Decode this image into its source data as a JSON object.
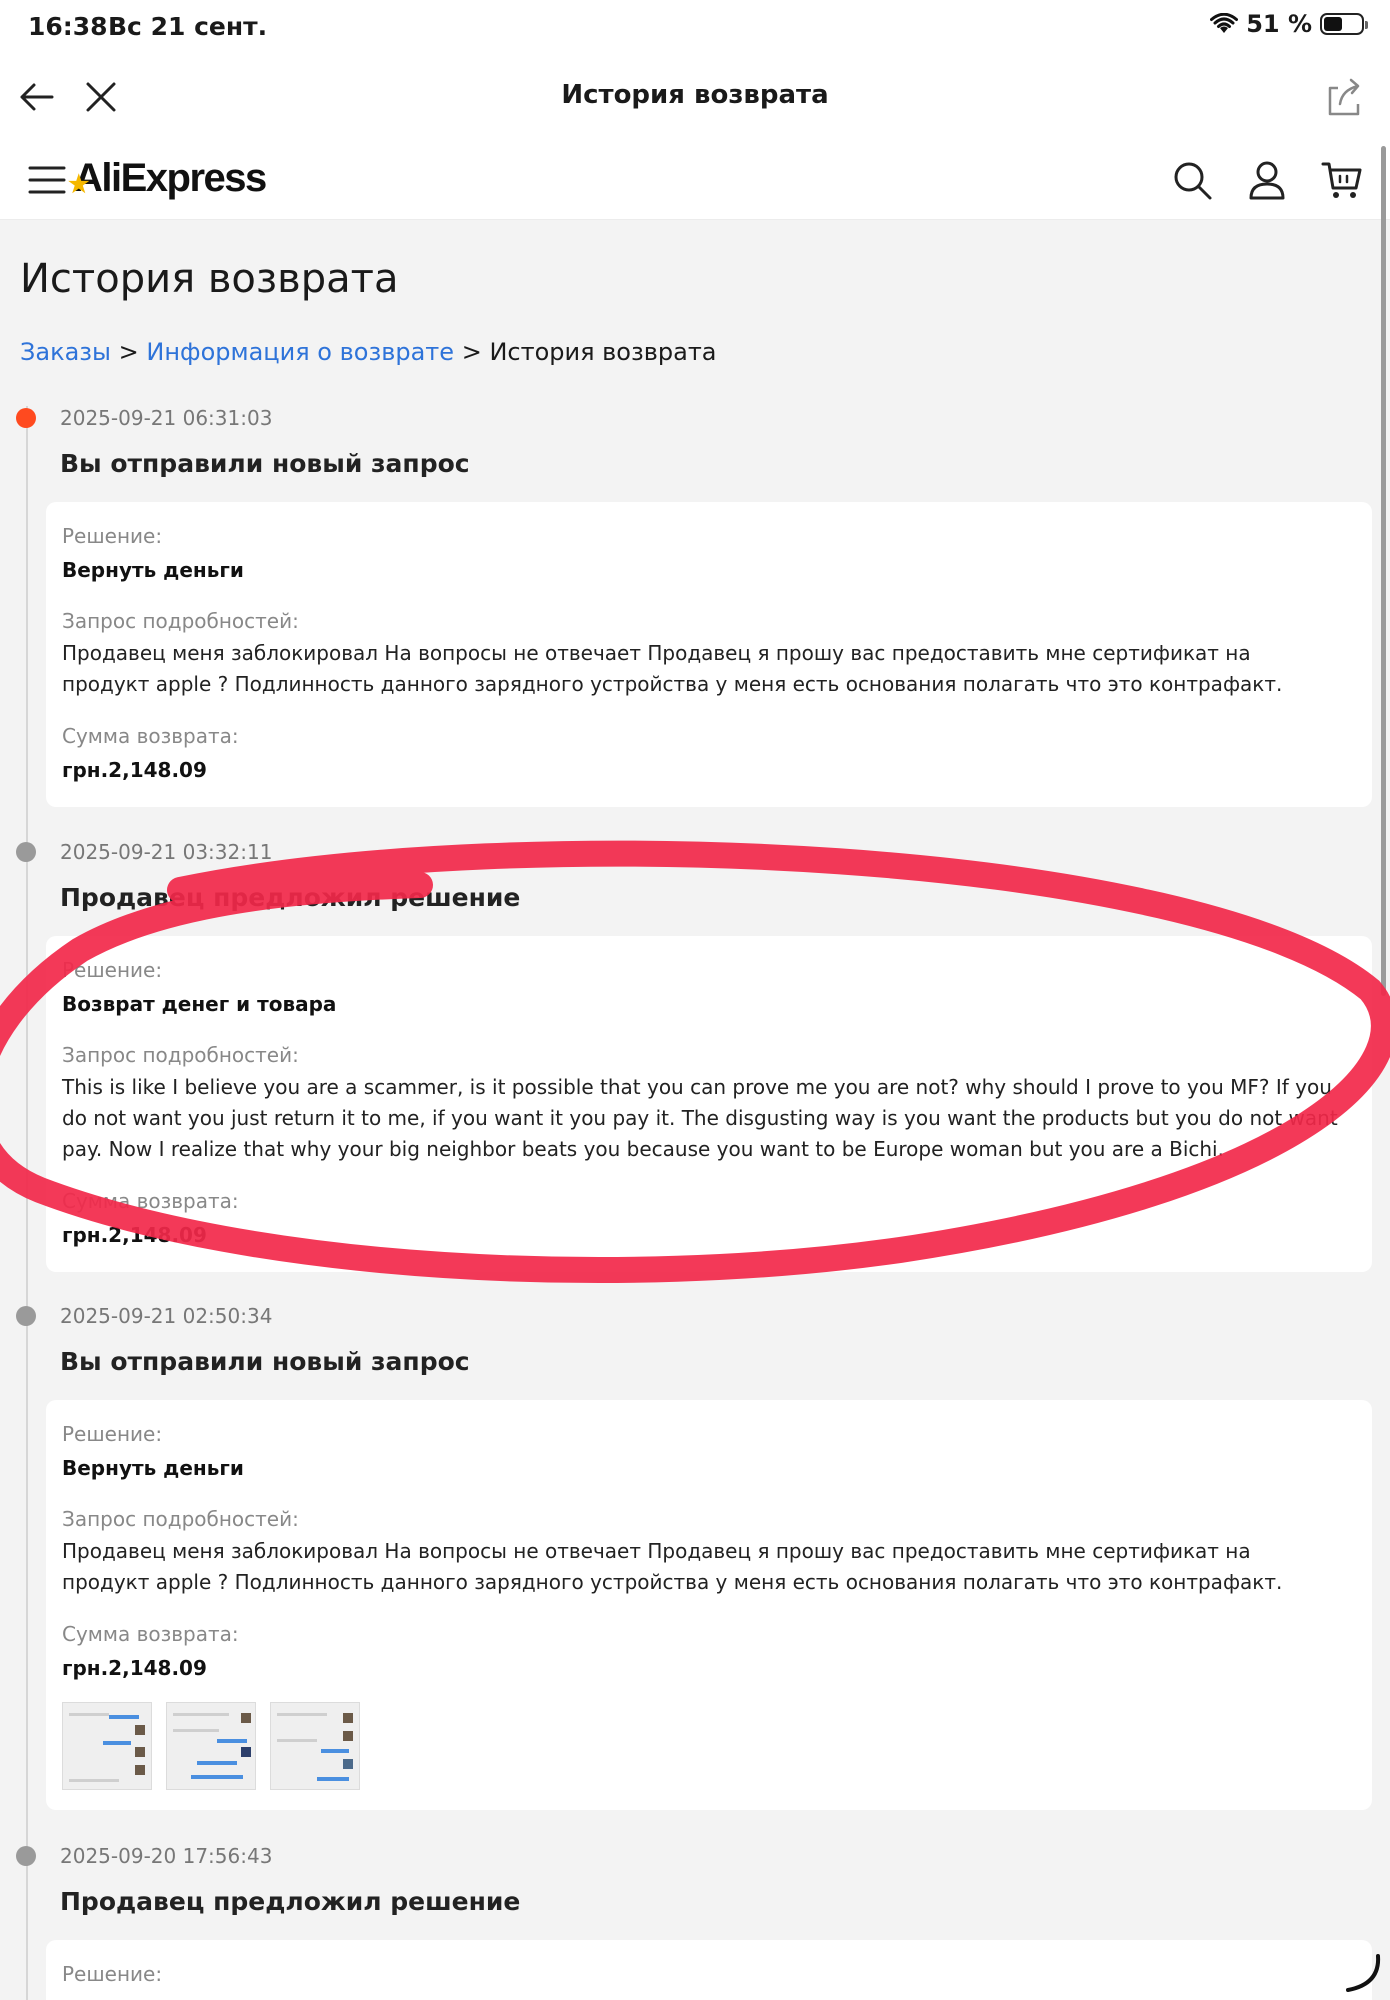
{
  "status_bar": {
    "time": "16:38",
    "date": "Вс 21 сент.",
    "battery": "51 %",
    "battery_level": 0.51
  },
  "nav": {
    "title": "История возврата"
  },
  "app": {
    "logo": "AliExpress"
  },
  "page": {
    "title": "История возврата",
    "breadcrumb": {
      "orders": "Заказы",
      "sep1": ">",
      "info": "Информация о возврате",
      "sep2": ">",
      "current": "История возврата"
    }
  },
  "entries": [
    {
      "timestamp": "2025-09-21 06:31:03",
      "title": "Вы отправили новый запрос",
      "decision_label": "Решение:",
      "decision": "Вернуть деньги",
      "details_label": "Запрос подробностей:",
      "details": "Продавец меня заблокировал На вопросы не отвечает Продавец я прошу вас предоставить мне сертификат на продукт apple ? Подлинность данного зарядного устройства у меня есть основания полагать что это контрафакт.",
      "amount_label": "Сумма возврата:",
      "amount": "грн.2,148.09"
    },
    {
      "timestamp": "2025-09-21 03:32:11",
      "title": "Продавец предложил решение",
      "decision_label": "Решение:",
      "decision": "Возврат денег и товара",
      "details_label": "Запрос подробностей:",
      "details": "This is like I believe you are a scammer, is it possible that you can prove me you are not? why should I prove to you MF? If you do not want you just return it to me, if you want it you pay it. The disgusting way is you want the products but you do not want pay. Now I realize that why your big neighbor beats you because you want to be Europe woman but you are a Bichi.",
      "amount_label": "Сумма возврата:",
      "amount": "грн.2,148.09"
    },
    {
      "timestamp": "2025-09-21 02:50:34",
      "title": "Вы отправили новый запрос",
      "decision_label": "Решение:",
      "decision": "Вернуть деньги",
      "details_label": "Запрос подробностей:",
      "details": "Продавец меня заблокировал На вопросы не отвечает Продавец я прошу вас предоставить мне сертификат на продукт apple ? Подлинность данного зарядного устройства у меня есть основания полагать что это контрафакт.",
      "amount_label": "Сумма возврата:",
      "amount": "грн.2,148.09"
    },
    {
      "timestamp": "2025-09-20 17:56:43",
      "title": "Продавец предложил решение",
      "decision_label": "Решение:"
    }
  ],
  "colors": {
    "accent": "#ff4a1f",
    "link": "#2e73d9",
    "annotation": "#f2284a"
  },
  "icons": [
    "back-arrow-icon",
    "close-icon",
    "share-icon",
    "menu-icon",
    "search-icon",
    "user-icon",
    "cart-icon",
    "wifi-icon",
    "battery-icon",
    "loading-spinner-icon"
  ]
}
